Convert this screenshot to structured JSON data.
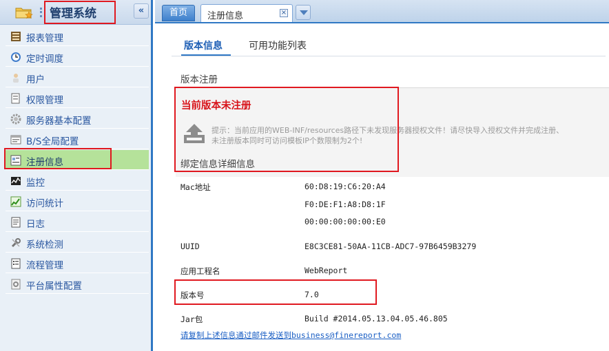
{
  "app": {
    "title": "管理系统",
    "collapse_symbol": "«"
  },
  "sidebar": {
    "items": [
      {
        "label": "报表管理",
        "icon": "report-icon"
      },
      {
        "label": "定时调度",
        "icon": "clock-icon"
      },
      {
        "label": "用户",
        "icon": "user-icon"
      },
      {
        "label": "权限管理",
        "icon": "permission-icon"
      },
      {
        "label": "服务器基本配置",
        "icon": "gear-icon"
      },
      {
        "label": "B/S全局配置",
        "icon": "global-config-icon"
      },
      {
        "label": "注册信息",
        "icon": "registration-icon",
        "active": true
      },
      {
        "label": "监控",
        "icon": "monitor-icon"
      },
      {
        "label": "访问统计",
        "icon": "statistics-icon"
      },
      {
        "label": "日志",
        "icon": "log-icon"
      },
      {
        "label": "系统检测",
        "icon": "wrench-icon"
      },
      {
        "label": "流程管理",
        "icon": "process-icon"
      },
      {
        "label": "平台属性配置",
        "icon": "platform-config-icon"
      }
    ]
  },
  "tabs": {
    "home": "首页",
    "registration": "注册信息",
    "close_symbol": "×"
  },
  "subtabs": {
    "version_info": "版本信息",
    "available_functions": "可用功能列表"
  },
  "registration": {
    "section_title": "版本注册",
    "status": "当前版本未注册",
    "hint_line1": "提示：当前应用的WEB-INF/resources路径下未发现服务器授权文件！请尽快导入授权文件并完成注册、",
    "hint_line2": "未注册版本同时可访问模板IP个数限制为2个!",
    "bind_title": "绑定信息详细信息"
  },
  "info": {
    "mac_label": "Mac地址",
    "mac_values": [
      "60:D8:19:C6:20:A4",
      "F0:DE:F1:A8:D8:1F",
      "00:00:00:00:00:E0"
    ],
    "uuid_label": "UUID",
    "uuid_value": "E8C3CE81-50AA-11CB-ADC7-97B6459B3279",
    "project_label": "应用工程名",
    "project_value": "WebReport",
    "version_label": "版本号",
    "version_value": "7.0",
    "jar_label": "Jar包",
    "jar_value": "Build #2014.05.13.04.05.46.805"
  },
  "email_link": "请复制上述信息通过邮件发送到business@finereport.com",
  "colors": {
    "accent": "#2f78c4",
    "status_red": "#d8141b",
    "active_item": "#b5e29a",
    "annotation_red": "#e0181f"
  }
}
